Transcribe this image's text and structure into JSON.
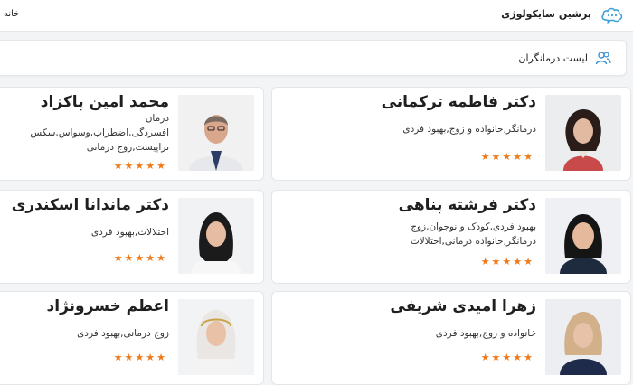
{
  "header": {
    "brand": "پرشین سایکولوژی",
    "home_link": "خانه"
  },
  "section": {
    "title": "لیست درمانگران"
  },
  "colors": {
    "star": "#ef7a1a",
    "brand": "#3aa0d8"
  },
  "therapists": [
    {
      "name": "دکتر فاطمه ترکمانی",
      "specialties": [
        "درمانگر,خانواده و زوج,بهبود فردی"
      ],
      "rating": "★★★★★"
    },
    {
      "name": "محمد امین پاکزاد",
      "specialties": [
        "درمان",
        "افسردگی,اضطراب,وسواس,سکس",
        "تراپیست,زوج درمانی"
      ],
      "rating": "★★★★★"
    },
    {
      "name": "دکتر فرشته پناهی",
      "specialties": [
        "بهبود فردی,کودک و نوجوان,زوج",
        "درمانگر,خانواده درمانی,اختلالات"
      ],
      "rating": "★★★★★"
    },
    {
      "name": "دکتر ماندانا اسکندری",
      "specialties": [
        "اختلالات,بهبود فردی"
      ],
      "rating": "★★★★★"
    },
    {
      "name": "زهرا امیدی شریفی",
      "specialties": [
        "خانواده و زوج,بهبود فردی"
      ],
      "rating": "★★★★★"
    },
    {
      "name": "اعظم خسرونژاد",
      "specialties": [
        "زوج درمانی,بهبود فردی"
      ],
      "rating": "★★★★★"
    }
  ]
}
